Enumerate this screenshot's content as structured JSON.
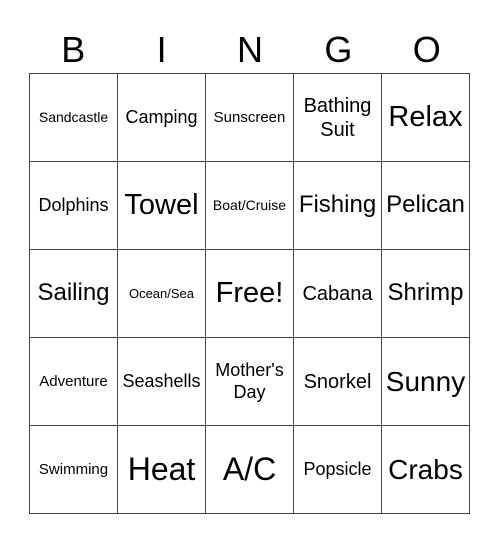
{
  "header": [
    "B",
    "I",
    "N",
    "G",
    "O"
  ],
  "cells": [
    [
      "Sandcastle",
      "Camping",
      "Sunscreen",
      "Bathing Suit",
      "Relax"
    ],
    [
      "Dolphins",
      "Towel",
      "Boat/Cruise",
      "Fishing",
      "Pelican"
    ],
    [
      "Sailing",
      "Ocean/Sea",
      "Free!",
      "Cabana",
      "Shrimp"
    ],
    [
      "Adventure",
      "Seashells",
      "Mother's Day",
      "Snorkel",
      "Sunny"
    ],
    [
      "Swimming",
      "Heat",
      "A/C",
      "Popsicle",
      "Crabs"
    ]
  ]
}
